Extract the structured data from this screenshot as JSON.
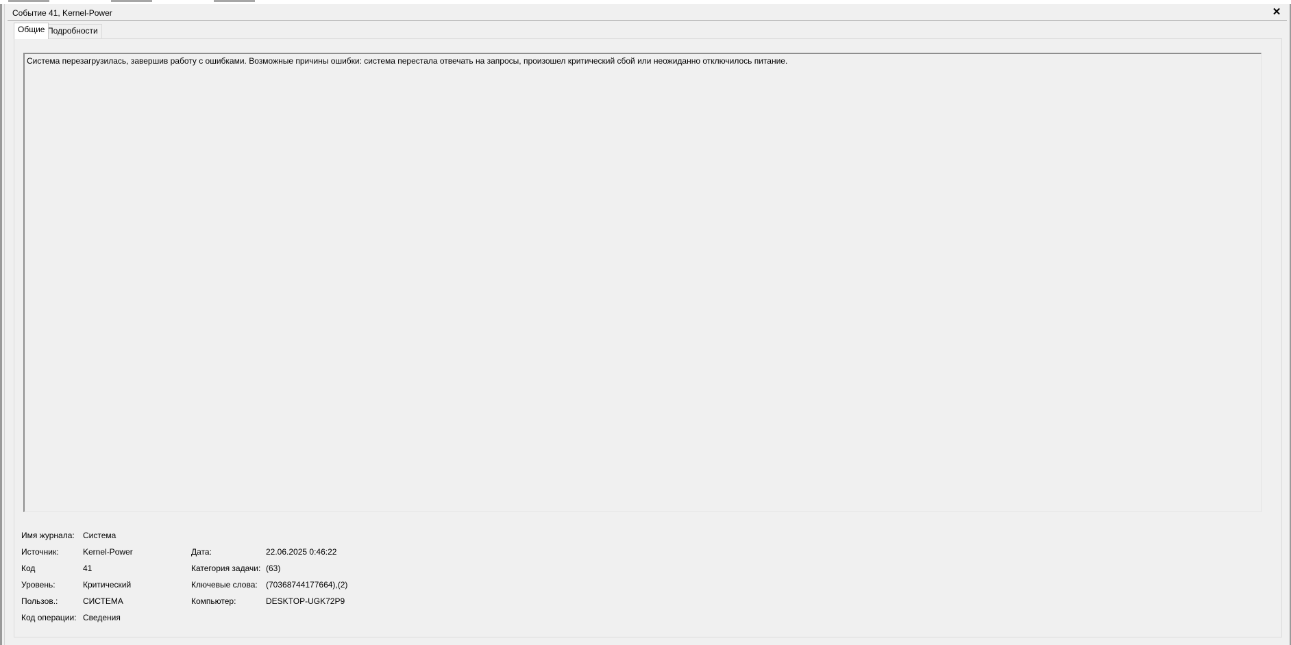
{
  "window": {
    "title": "Событие 41, Kernel-Power",
    "close_glyph": "✕"
  },
  "tabs": [
    {
      "label": "Общие",
      "active": true
    },
    {
      "label": "Подробности",
      "active": false
    }
  ],
  "description": "Система перезагрузилась, завершив работу с ошибками. Возможные причины ошибки: система перестала отвечать на запросы, произошел критический сбой или неожиданно отключилось питание.",
  "fields": {
    "log_name": {
      "label": "Имя журнала:",
      "value": "Система"
    },
    "source": {
      "label": "Источник:",
      "value": "Kernel-Power"
    },
    "code": {
      "label": "Код",
      "value": "41"
    },
    "level": {
      "label": "Уровень:",
      "value": "Критический"
    },
    "user": {
      "label": "Пользов.:",
      "value": "СИСТЕМА"
    },
    "opcode": {
      "label": "Код операции:",
      "value": "Сведения"
    },
    "date": {
      "label": "Дата:",
      "value": "22.06.2025 0:46:22"
    },
    "task_category": {
      "label": "Категория задачи:",
      "value": "(63)"
    },
    "keywords": {
      "label": "Ключевые слова:",
      "value": "(70368744177664),(2)"
    },
    "computer": {
      "label": "Компьютер:",
      "value": "DESKTOP-UGK72P9"
    }
  },
  "colors": {
    "window_bg": "#f0f0f0",
    "border": "#a0a0a0"
  }
}
